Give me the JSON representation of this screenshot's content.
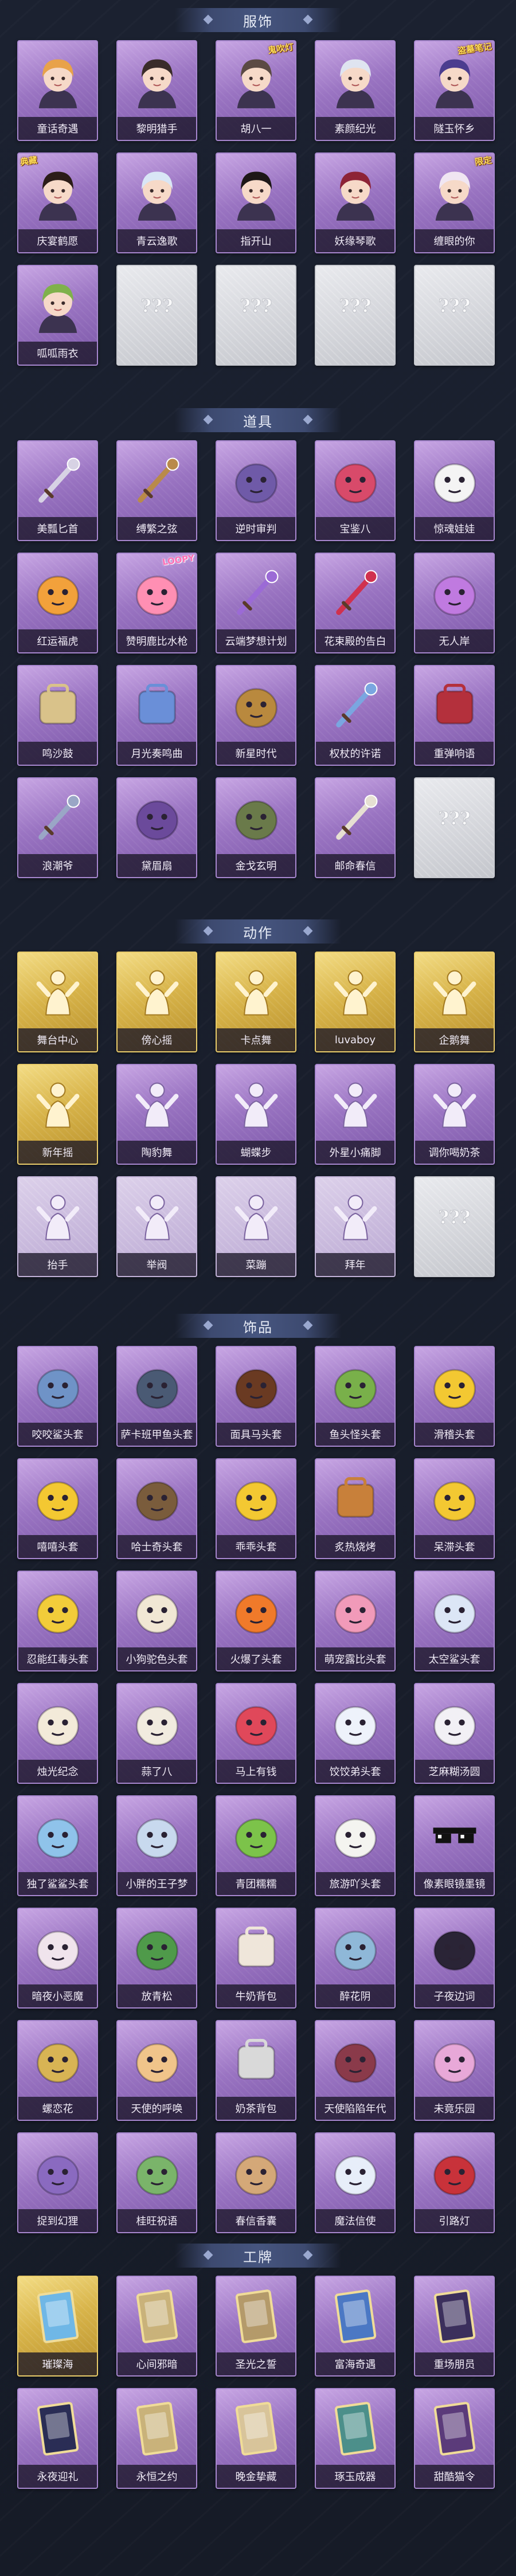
{
  "sections": [
    {
      "title": "服饰",
      "items": [
        {
          "label": "童话奇遇",
          "icon": "girl-portrait-icon",
          "tier": "purple"
        },
        {
          "label": "黎明猎手",
          "icon": "boy-portrait-icon",
          "tier": "purple"
        },
        {
          "label": "胡八一",
          "icon": "explorer-portrait-icon",
          "tier": "purple",
          "badge": "鬼吹灯"
        },
        {
          "label": "素颜纪光",
          "icon": "silver-hair-portrait-icon",
          "tier": "purple"
        },
        {
          "label": "隧玉怀乡",
          "icon": "blue-hair-portrait-icon",
          "tier": "purple",
          "badge": "盗墓笔记"
        },
        {
          "label": "庆宴鹤愿",
          "icon": "opera-portrait-icon",
          "tier": "purple",
          "badge": "典藏"
        },
        {
          "label": "青云逸歌",
          "icon": "white-hair-portrait-icon",
          "tier": "purple"
        },
        {
          "label": "指开山",
          "icon": "dark-hair-portrait-icon",
          "tier": "purple"
        },
        {
          "label": "妖缘琴歌",
          "icon": "red-hair-portrait-icon",
          "tier": "purple"
        },
        {
          "label": "缠眼的你",
          "icon": "witch-portrait-icon",
          "tier": "purple",
          "badge": "限定"
        },
        {
          "label": "呱呱雨衣",
          "icon": "frog-portrait-icon",
          "tier": "purple"
        },
        {
          "label": "",
          "icon": "locked-placeholder-icon",
          "tier": "locked"
        },
        {
          "label": "",
          "icon": "locked-placeholder-icon",
          "tier": "locked"
        },
        {
          "label": "",
          "icon": "locked-placeholder-icon",
          "tier": "locked"
        },
        {
          "label": "",
          "icon": "locked-placeholder-icon",
          "tier": "locked"
        }
      ]
    },
    {
      "title": "道具",
      "items": [
        {
          "label": "美瓢匕首",
          "icon": "dagger-icon",
          "tier": "purple"
        },
        {
          "label": "缚繁之弦",
          "icon": "bow-icon",
          "tier": "purple"
        },
        {
          "label": "逆时审判",
          "icon": "pocket-watch-icon",
          "tier": "purple"
        },
        {
          "label": "宝鉴八",
          "icon": "heart-mirror-icon",
          "tier": "purple"
        },
        {
          "label": "惊魂娃娃",
          "icon": "panda-doll-icon",
          "tier": "purple"
        },
        {
          "label": "红运福虎",
          "icon": "tiger-icon",
          "tier": "purple"
        },
        {
          "label": "赞明鹿比水枪",
          "icon": "water-gun-icon",
          "tier": "purple",
          "badge": "LOOPY"
        },
        {
          "label": "云端梦想计划",
          "icon": "magic-wand-icon",
          "tier": "purple"
        },
        {
          "label": "花束殿的告白",
          "icon": "rose-icon",
          "tier": "purple"
        },
        {
          "label": "无人岸",
          "icon": "potion-icon",
          "tier": "purple"
        },
        {
          "label": "鸣沙鼓",
          "icon": "drum-icon",
          "tier": "purple"
        },
        {
          "label": "月光奏鸣曲",
          "icon": "piano-icon",
          "tier": "purple"
        },
        {
          "label": "新星时代",
          "icon": "revolver-icon",
          "tier": "purple"
        },
        {
          "label": "权杖的许诺",
          "icon": "scepter-icon",
          "tier": "purple"
        },
        {
          "label": "重弹响语",
          "icon": "medkit-icon",
          "tier": "purple"
        },
        {
          "label": "浪潮爷",
          "icon": "staff-icon",
          "tier": "purple"
        },
        {
          "label": "黛眉扇",
          "icon": "fan-icon",
          "tier": "purple"
        },
        {
          "label": "金戈玄明",
          "icon": "lantern-icon",
          "tier": "purple"
        },
        {
          "label": "邮命春信",
          "icon": "feather-icon",
          "tier": "purple"
        },
        {
          "label": "",
          "icon": "locked-placeholder-icon",
          "tier": "locked"
        }
      ]
    },
    {
      "title": "动作",
      "items": [
        {
          "label": "舞台中心",
          "icon": "figure-pose-icon",
          "tier": "gold"
        },
        {
          "label": "傍心摇",
          "icon": "figure-cheer-icon",
          "tier": "gold"
        },
        {
          "label": "卡点舞",
          "icon": "figure-dance-icon",
          "tier": "gold"
        },
        {
          "label": "luvaboy",
          "icon": "figure-bow-icon",
          "tier": "gold"
        },
        {
          "label": "企鹅舞",
          "icon": "figure-wave-icon",
          "tier": "gold"
        },
        {
          "label": "新年摇",
          "icon": "figure-shake-icon",
          "tier": "gold"
        },
        {
          "label": "陶豹舞",
          "icon": "figure-cheer-icon",
          "tier": "purple"
        },
        {
          "label": "蝴蝶步",
          "icon": "figure-dance-icon",
          "tier": "purple"
        },
        {
          "label": "外星小痛脚",
          "icon": "figure-pose-icon",
          "tier": "purple"
        },
        {
          "label": "调你喝奶茶",
          "icon": "figure-wave-icon",
          "tier": "purple"
        },
        {
          "label": "抬手",
          "icon": "figure-pose-icon",
          "tier": "faded"
        },
        {
          "label": "举阀",
          "icon": "robot-figure-icon",
          "tier": "faded"
        },
        {
          "label": "菜蹦",
          "icon": "figure-dance-icon",
          "tier": "faded"
        },
        {
          "label": "拜年",
          "icon": "figure-bow-icon",
          "tier": "faded"
        },
        {
          "label": "",
          "icon": "locked-placeholder-icon",
          "tier": "locked"
        }
      ]
    },
    {
      "title": "饰品",
      "items": [
        {
          "label": "咬咬鲨头套",
          "icon": "shark-head-icon",
          "tier": "purple"
        },
        {
          "label": "萨卡班甲鱼头套",
          "icon": "fish-head-icon",
          "tier": "purple"
        },
        {
          "label": "面具马头套",
          "icon": "horse-head-icon",
          "tier": "purple"
        },
        {
          "label": "鱼头怪头套",
          "icon": "frog-head-icon",
          "tier": "purple"
        },
        {
          "label": "滑稽头套",
          "icon": "smiley-head-icon",
          "tier": "purple"
        },
        {
          "label": "嘻嘻头套",
          "icon": "grin-head-icon",
          "tier": "purple"
        },
        {
          "label": "哈士奇头套",
          "icon": "husky-head-icon",
          "tier": "purple"
        },
        {
          "label": "乖乖头套",
          "icon": "shy-face-icon",
          "tier": "purple"
        },
        {
          "label": "炙热烧烤",
          "icon": "toast-icon",
          "tier": "purple"
        },
        {
          "label": "呆滞头套",
          "icon": "dazed-face-icon",
          "tier": "purple"
        },
        {
          "label": "忍能红毒头套",
          "icon": "pikachu-head-icon",
          "tier": "purple"
        },
        {
          "label": "小狗驼色头套",
          "icon": "blob-icon",
          "tier": "purple"
        },
        {
          "label": "火爆了头套",
          "icon": "flame-head-icon",
          "tier": "purple"
        },
        {
          "label": "萌宠露比头套",
          "icon": "pink-beaver-icon",
          "tier": "purple"
        },
        {
          "label": "太空鲨头套",
          "icon": "ghost-shark-icon",
          "tier": "purple"
        },
        {
          "label": "烛光纪念",
          "icon": "candle-icon",
          "tier": "purple"
        },
        {
          "label": "蒜了八",
          "icon": "garlic-icon",
          "tier": "purple"
        },
        {
          "label": "马上有钱",
          "icon": "red-bird-icon",
          "tier": "purple"
        },
        {
          "label": "饺饺弟头套",
          "icon": "cinnamoroll-icon",
          "tier": "purple"
        },
        {
          "label": "芝麻糊汤圆",
          "icon": "rice-ball-icon",
          "tier": "purple"
        },
        {
          "label": "独了鲨鲨头套",
          "icon": "blue-shark-icon",
          "tier": "purple"
        },
        {
          "label": "小胖的王子梦",
          "icon": "crown-creature-icon",
          "tier": "purple"
        },
        {
          "label": "青团糯糯",
          "icon": "green-dumpling-icon",
          "tier": "purple"
        },
        {
          "label": "旅游吖头套",
          "icon": "duck-head-icon",
          "tier": "purple"
        },
        {
          "label": "像素眼镜墨镜",
          "icon": "pixel-sunglasses-icon",
          "tier": "purple"
        },
        {
          "label": "暗夜小恶魔",
          "icon": "devil-icon",
          "tier": "purple"
        },
        {
          "label": "放青松",
          "icon": "bonsai-icon",
          "tier": "purple"
        },
        {
          "label": "牛奶背包",
          "icon": "milk-backpack-icon",
          "tier": "purple"
        },
        {
          "label": "醉花阴",
          "icon": "flower-hairpin-icon",
          "tier": "purple"
        },
        {
          "label": "子夜边词",
          "icon": "dark-flower-icon",
          "tier": "purple"
        },
        {
          "label": "螺恋花",
          "icon": "bell-ornament-icon",
          "tier": "purple"
        },
        {
          "label": "天使的呼唤",
          "icon": "angel-doll-icon",
          "tier": "purple"
        },
        {
          "label": "奶茶背包",
          "icon": "qr-backpack-icon",
          "tier": "purple"
        },
        {
          "label": "天使陷陷年代",
          "icon": "girl-doll-icon",
          "tier": "purple"
        },
        {
          "label": "未竟乐园",
          "icon": "pink-doll-icon",
          "tier": "purple"
        },
        {
          "label": "捉到幻狸",
          "icon": "hanging-charm-icon",
          "tier": "purple"
        },
        {
          "label": "桂旺祝语",
          "icon": "green-doll-icon",
          "tier": "purple"
        },
        {
          "label": "春信香囊",
          "icon": "sachet-icon",
          "tier": "purple"
        },
        {
          "label": "魔法信使",
          "icon": "mouse-doll-icon",
          "tier": "purple"
        },
        {
          "label": "引路灯",
          "icon": "red-lantern-icon",
          "tier": "purple"
        }
      ]
    },
    {
      "title": "工牌",
      "items": [
        {
          "label": "璀璨海",
          "icon": "ocean-card-icon",
          "tier": "gold"
        },
        {
          "label": "心间邪暗",
          "icon": "gold-frame-card-icon",
          "tier": "purple"
        },
        {
          "label": "圣光之誓",
          "icon": "ornate-card-icon",
          "tier": "purple"
        },
        {
          "label": "富海奇遇",
          "icon": "blue-card-icon",
          "tier": "purple"
        },
        {
          "label": "重场朋员",
          "icon": "dark-card-icon",
          "tier": "purple"
        },
        {
          "label": "永夜迎礼",
          "icon": "night-card-icon",
          "tier": "purple"
        },
        {
          "label": "永恒之约",
          "icon": "gold-frame-card-icon",
          "tier": "purple"
        },
        {
          "label": "晚金挚藏",
          "icon": "tarot-card-icon",
          "tier": "purple"
        },
        {
          "label": "琢玉成器",
          "icon": "jade-card-icon",
          "tier": "purple"
        },
        {
          "label": "甜酷猫令",
          "icon": "cat-card-icon",
          "tier": "purple"
        }
      ]
    }
  ],
  "colors": {
    "page_bg": "#171c28",
    "purple_frame": "#a787cf",
    "gold_frame": "#e9cc6a",
    "label_bg": "#1a1626"
  }
}
